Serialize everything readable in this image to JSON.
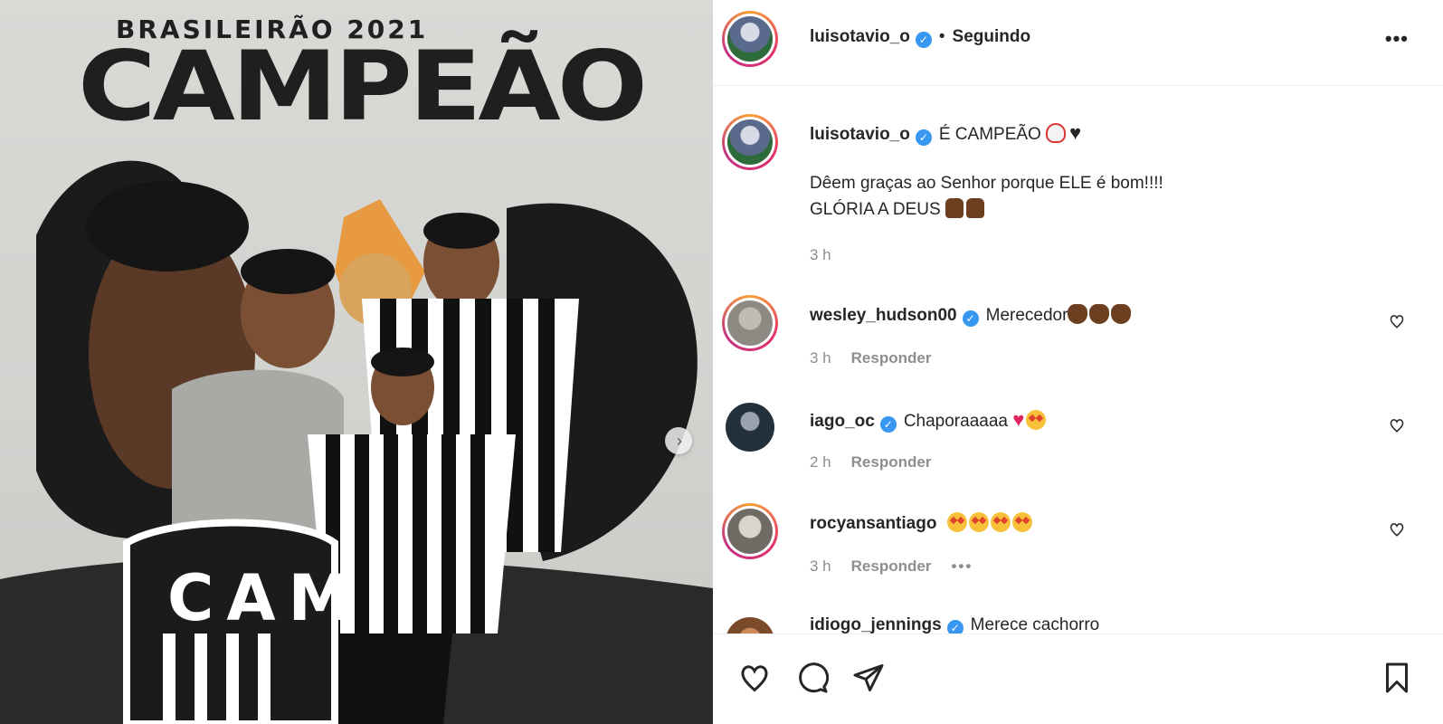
{
  "media": {
    "heading": "BRASILEIRÃO 2021",
    "title": "CAMPEÃO",
    "shield_text": "CAM",
    "next_icon": "chevron-right-icon"
  },
  "header": {
    "username": "luisotavio_o",
    "separator": "•",
    "follow_status": "Seguindo",
    "more_icon": "more-horizontal-icon"
  },
  "caption": {
    "username": "luisotavio_o",
    "text": "É CAMPEÃO",
    "line2": "Dêem graças ao Senhor porque ELE é bom!!!!",
    "line3": "GLÓRIA A DEUS",
    "time": "3 h"
  },
  "comments": [
    {
      "username": "wesley_hudson00",
      "verified": true,
      "text": "Merecedor",
      "time": "3 h",
      "reply": "Responder"
    },
    {
      "username": "iago_oc",
      "verified": true,
      "text": "Chaporaaaaa",
      "time": "2 h",
      "reply": "Responder"
    },
    {
      "username": "rocyansantiago",
      "verified": false,
      "text": "",
      "time": "3 h",
      "reply": "Responder",
      "more": "•••"
    },
    {
      "username": "idiogo_jennings",
      "verified": true,
      "text": "Merece cachorro"
    }
  ],
  "actions": {
    "like_icon": "heart-icon",
    "comment_icon": "comment-icon",
    "share_icon": "send-icon",
    "save_icon": "bookmark-icon"
  },
  "colors": {
    "verified_blue": "#3897f0",
    "meta_gray": "#8e8e8e",
    "text": "#262626"
  }
}
